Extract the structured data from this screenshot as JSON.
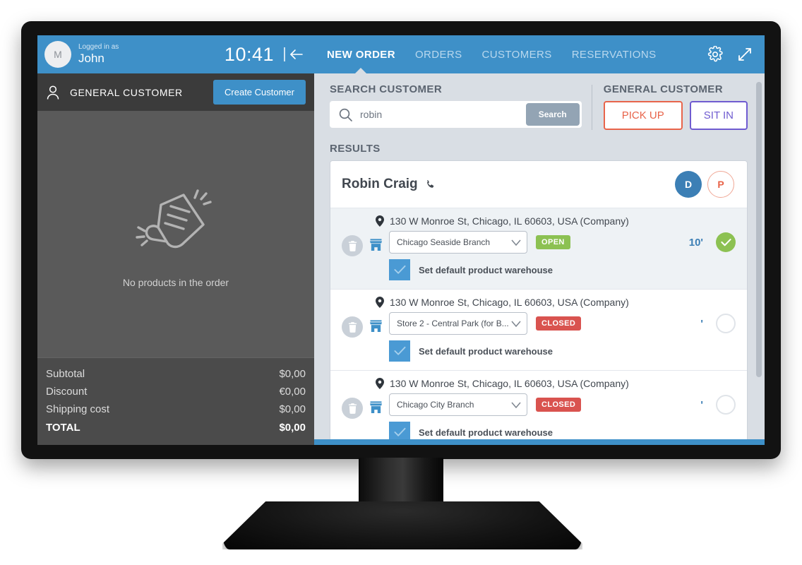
{
  "header": {
    "avatar_initial": "M",
    "logged_in_label": "Logged in as",
    "user_name": "John",
    "clock": "10:41",
    "collapse_icon": "collapse-left-arrow-icon"
  },
  "nav": {
    "tabs": [
      {
        "label": "NEW ORDER",
        "active": true
      },
      {
        "label": "ORDERS",
        "active": false
      },
      {
        "label": "CUSTOMERS",
        "active": false
      },
      {
        "label": "RESERVATIONS",
        "active": false
      }
    ],
    "settings_icon": "gear-icon",
    "expand_icon": "expand-arrows-icon"
  },
  "order_panel": {
    "customer_label": "GENERAL CUSTOMER",
    "create_customer_label": "Create Customer",
    "empty_text": "No products in the order",
    "totals": [
      {
        "label": "Subtotal",
        "value": "$0,00"
      },
      {
        "label": "Discount",
        "value": "€0,00"
      },
      {
        "label": "Shipping cost",
        "value": "$0,00"
      }
    ],
    "grand_total": {
      "label": "TOTAL",
      "value": "$0,00"
    }
  },
  "search": {
    "section_label": "SEARCH CUSTOMER",
    "value": "robin",
    "placeholder": "Search customer",
    "button_label": "Search",
    "icon": "search-icon"
  },
  "general_customer": {
    "section_label": "GENERAL CUSTOMER",
    "pick_up_label": "PICK UP",
    "sit_in_label": "SIT IN"
  },
  "results": {
    "section_label": "RESULTS",
    "customer": {
      "name": "Robin Craig",
      "phone_icon": "phone-icon",
      "badges": [
        {
          "letter": "D",
          "style": "filled"
        },
        {
          "letter": "P",
          "style": "outline"
        }
      ]
    },
    "rows": [
      {
        "address": "130 W Monroe St, Chicago, IL 60603, USA (Company)",
        "warehouse": "Chicago Seaside Branch",
        "status": "OPEN",
        "status_kind": "open",
        "eta": "10'",
        "selected": true,
        "default_warehouse_label": "Set default product warehouse",
        "default_warehouse_checked": true
      },
      {
        "address": "130 W Monroe St, Chicago, IL 60603, USA (Company)",
        "warehouse": "Store 2 - Central Park (for B...",
        "status": "CLOSED",
        "status_kind": "closed",
        "eta": "'",
        "selected": false,
        "default_warehouse_label": "Set default product warehouse",
        "default_warehouse_checked": true
      },
      {
        "address": "130 W Monroe St, Chicago, IL 60603, USA (Company)",
        "warehouse": "Chicago City Branch",
        "status": "CLOSED",
        "status_kind": "closed",
        "eta": "'",
        "selected": false,
        "default_warehouse_label": "Set default product warehouse",
        "default_warehouse_checked": true
      }
    ]
  },
  "colors": {
    "brand_blue": "#3e90c8",
    "accent_orange": "#e8644a",
    "accent_purple": "#6f5bd0",
    "status_open": "#8cc152",
    "status_closed": "#d9534f",
    "panel_dark": "#5a5a5a"
  }
}
